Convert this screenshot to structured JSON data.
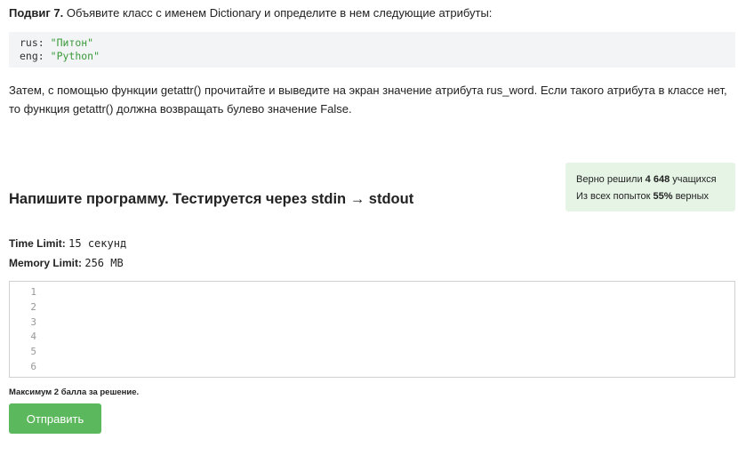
{
  "task": {
    "label": "Подвиг 7.",
    "text": " Объявите класс с именем Dictionary и определите в нем следующие атрибуты:"
  },
  "code_example": {
    "lines": [
      {
        "key": "rus",
        "sep": ": ",
        "value": "\"Питон\""
      },
      {
        "key": "eng",
        "sep": ": ",
        "value": "\"Python\""
      }
    ]
  },
  "description": "Затем, с помощью функции getattr() прочитайте и выведите на экран значение атрибута rus_word. Если такого атрибута в классе нет, то функция getattr() должна возвращать булево значение False.",
  "stats": {
    "solved_prefix": "Верно решили ",
    "solved_count": "4 648",
    "solved_suffix": " учащихся",
    "attempts_prefix": "Из всех попыток ",
    "attempts_percent": "55%",
    "attempts_suffix": " верных"
  },
  "heading": "Напишите программу. Тестируется через stdin → stdout",
  "limits": {
    "time_label": "Time Limit:",
    "time_value": "15 секунд",
    "memory_label": "Memory Limit:",
    "memory_value": "256 MB"
  },
  "editor": {
    "line_numbers": [
      "1",
      "2",
      "3",
      "4",
      "5",
      "6"
    ]
  },
  "note": "Максимум 2 балла за решение.",
  "submit_label": "Отправить"
}
